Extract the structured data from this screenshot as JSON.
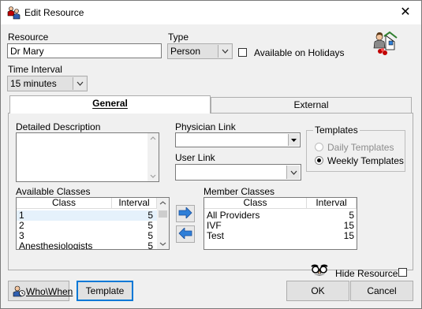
{
  "window": {
    "title": "Edit Resource",
    "close_glyph": "✕"
  },
  "resource": {
    "label": "Resource",
    "value": "Dr Mary"
  },
  "type": {
    "label": "Type",
    "value": "Person"
  },
  "holidays": {
    "label": "Available on Holidays",
    "checked": false
  },
  "time_interval": {
    "label": "Time Interval",
    "value": "15 minutes"
  },
  "tabs": [
    {
      "label": "General",
      "active": true
    },
    {
      "label": "External",
      "active": false
    }
  ],
  "general": {
    "description_label": "Detailed Description",
    "physician_link_label": "Physician Link",
    "physician_link_value": "",
    "user_link_label": "User Link",
    "user_link_value": "",
    "templates": {
      "title": "Templates",
      "options": [
        {
          "label": "Daily Templates",
          "checked": false,
          "enabled": false
        },
        {
          "label": "Weekly Templates",
          "checked": true,
          "enabled": true
        }
      ]
    },
    "available_classes": {
      "label": "Available Classes",
      "columns": [
        "Class",
        "Interval"
      ],
      "rows": [
        {
          "class": "1",
          "interval": "5"
        },
        {
          "class": "2",
          "interval": "5"
        },
        {
          "class": "3",
          "interval": "5"
        },
        {
          "class": "Anesthesiologists",
          "interval": "5"
        }
      ]
    },
    "member_classes": {
      "label": "Member Classes",
      "columns": [
        "Class",
        "Interval"
      ],
      "rows": [
        {
          "class": "All Providers",
          "interval": "5"
        },
        {
          "class": "IVF",
          "interval": "15"
        },
        {
          "class": "Test",
          "interval": "15"
        }
      ]
    }
  },
  "hide_resource": {
    "label": "Hide Resource",
    "checked": false
  },
  "buttons": {
    "who_when": "Who\\When",
    "template": "Template",
    "ok": "OK",
    "cancel": "Cancel"
  },
  "colors": {
    "accent": "#0078d7",
    "arrow": "#2f7fd8",
    "selected_row": "#e5f1fb"
  },
  "icons": {
    "title_icon": "resource-people-icon",
    "resource_icon": "resource-home-icon",
    "hide_icon": "disguise-glasses-icon",
    "who_when_icon": "who-when-icon"
  }
}
